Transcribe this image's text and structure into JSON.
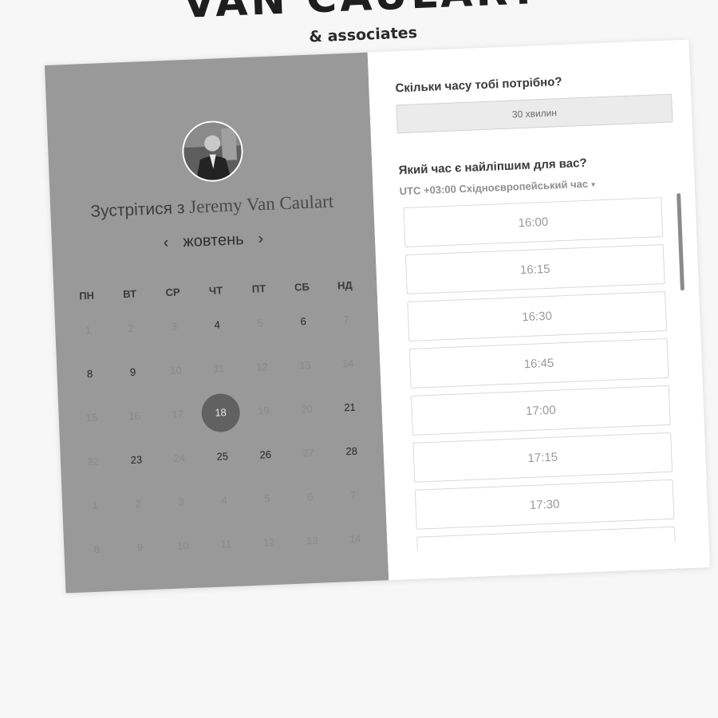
{
  "brand": {
    "name": "VAN CAULART",
    "tagline": "& associates"
  },
  "left": {
    "meet_prefix": "Зустрітися з",
    "host_name": "Jeremy Van Caulart",
    "month": "жовтень",
    "prev_arrow": "‹",
    "next_arrow": "›",
    "weekdays": [
      "ПН",
      "ВТ",
      "СР",
      "ЧТ",
      "ПТ",
      "СБ",
      "НД"
    ],
    "weeks": [
      [
        {
          "d": "1",
          "s": "dim"
        },
        {
          "d": "2",
          "s": "dim"
        },
        {
          "d": "3",
          "s": "dim"
        },
        {
          "d": "4",
          "s": "av"
        },
        {
          "d": "5",
          "s": "dim"
        },
        {
          "d": "6",
          "s": "av"
        },
        {
          "d": "7",
          "s": "dim"
        }
      ],
      [
        {
          "d": "8",
          "s": "av"
        },
        {
          "d": "9",
          "s": "av"
        },
        {
          "d": "10",
          "s": "dim"
        },
        {
          "d": "11",
          "s": "dim"
        },
        {
          "d": "12",
          "s": "dim"
        },
        {
          "d": "13",
          "s": "dim"
        },
        {
          "d": "14",
          "s": "dim"
        }
      ],
      [
        {
          "d": "15",
          "s": "dim"
        },
        {
          "d": "16",
          "s": "dim"
        },
        {
          "d": "17",
          "s": "dim"
        },
        {
          "d": "18",
          "s": "sel"
        },
        {
          "d": "19",
          "s": "dim"
        },
        {
          "d": "20",
          "s": "dim"
        },
        {
          "d": "21",
          "s": "av"
        }
      ],
      [
        {
          "d": "22",
          "s": "dim"
        },
        {
          "d": "23",
          "s": "av"
        },
        {
          "d": "24",
          "s": "dim"
        },
        {
          "d": "25",
          "s": "av"
        },
        {
          "d": "26",
          "s": "av"
        },
        {
          "d": "27",
          "s": "dim"
        },
        {
          "d": "28",
          "s": "av"
        }
      ],
      [
        {
          "d": "1",
          "s": "dim"
        },
        {
          "d": "2",
          "s": "dim"
        },
        {
          "d": "3",
          "s": "dim"
        },
        {
          "d": "4",
          "s": "dim"
        },
        {
          "d": "5",
          "s": "dim"
        },
        {
          "d": "6",
          "s": "dim"
        },
        {
          "d": "7",
          "s": "dim"
        }
      ],
      [
        {
          "d": "8",
          "s": "dim"
        },
        {
          "d": "9",
          "s": "dim"
        },
        {
          "d": "10",
          "s": "dim"
        },
        {
          "d": "11",
          "s": "dim"
        },
        {
          "d": "12",
          "s": "dim"
        },
        {
          "d": "13",
          "s": "dim"
        },
        {
          "d": "14",
          "s": "dim"
        }
      ]
    ]
  },
  "right": {
    "duration_question": "Скільки часу тобі потрібно?",
    "duration_value": "30 хвилин",
    "time_question": "Який час є найліпшим для вас?",
    "timezone": "UTC +03:00 Східноєвропейський час",
    "timezone_caret": "▾",
    "slots": [
      "16:00",
      "16:15",
      "16:30",
      "16:45",
      "17:00",
      "17:15",
      "17:30",
      ""
    ]
  },
  "colors": {
    "panel_left": "#999999",
    "selected_day": "#616161",
    "page_bg": "#f7f7f7"
  }
}
